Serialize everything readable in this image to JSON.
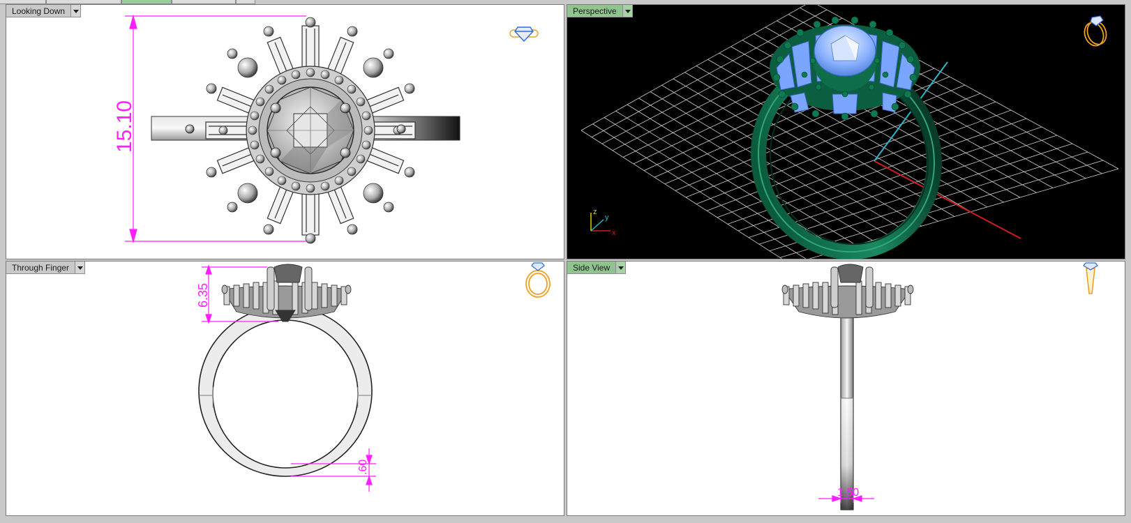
{
  "app": {
    "top_tabs": [
      "",
      "",
      "",
      "",
      ""
    ]
  },
  "viewports": {
    "top_left": {
      "label": "Looking Down",
      "dimension": "15.10",
      "icon": "ring-top-icon"
    },
    "top_right": {
      "label": "Perspective",
      "axes": {
        "x": "x",
        "y": "y",
        "z": "z"
      },
      "icon": "ring-perspective-icon"
    },
    "bottom_left": {
      "label": "Through Finger",
      "dimension_top": "6.35",
      "dimension_bottom": ".60",
      "icon": "ring-front-icon"
    },
    "bottom_right": {
      "label": "Side View",
      "dimension": "1.50",
      "icon": "ring-side-icon"
    }
  },
  "colors": {
    "dimension": "#ff1fff",
    "active_label": "#8fc48f",
    "icon_outline": "#f0a020",
    "gem_blue": "#8ab2ff",
    "metal_green": "#0d6b48",
    "axis_x": "#d21c1c",
    "axis_y": "#2ab8c8",
    "grid": "#d0d0d0"
  }
}
